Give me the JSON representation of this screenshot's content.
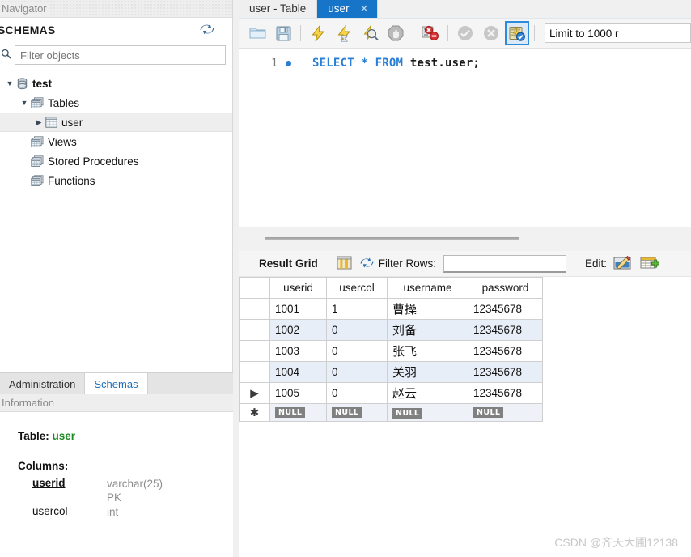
{
  "left_panel": {
    "caption": "Navigator",
    "schemas_title": "SCHEMAS",
    "refresh_icon": "refresh-icon",
    "search_icon": "search-icon",
    "filter_placeholder": "Filter objects",
    "filter_value": "",
    "tree": [
      {
        "label": "test",
        "icon": "database-icon",
        "expander": "▼",
        "depth": 0,
        "bold": true,
        "selected": false
      },
      {
        "label": "Tables",
        "icon": "table-group-icon",
        "expander": "▼",
        "depth": 1,
        "bold": false,
        "selected": false
      },
      {
        "label": "user",
        "icon": "table-icon",
        "expander": "▶",
        "depth": 2,
        "bold": false,
        "selected": true
      },
      {
        "label": "Views",
        "icon": "table-group-icon",
        "expander": "",
        "depth": 1,
        "bold": false,
        "selected": false
      },
      {
        "label": "Stored Procedures",
        "icon": "table-group-icon",
        "expander": "",
        "depth": 1,
        "bold": false,
        "selected": false
      },
      {
        "label": "Functions",
        "icon": "table-group-icon",
        "expander": "",
        "depth": 1,
        "bold": false,
        "selected": false
      }
    ],
    "bottom_tabs": [
      {
        "label": "Administration",
        "active": false
      },
      {
        "label": "Schemas",
        "active": true
      }
    ],
    "information": {
      "caption": "Information",
      "table_label": "Table:",
      "table_name": "user",
      "columns_label": "Columns:",
      "columns": [
        {
          "name": "userid",
          "type": "varchar(25)",
          "extra": "PK",
          "pk": true
        },
        {
          "name": "usercol",
          "type": "int",
          "extra": "",
          "pk": false
        }
      ]
    }
  },
  "editor": {
    "tabs": [
      {
        "label": "user - Table",
        "active": false,
        "closable": false
      },
      {
        "label": "user",
        "active": true,
        "closable": true,
        "close_icon": "close-icon"
      }
    ],
    "toolbar": {
      "buttons": [
        {
          "name": "open-sql-script-icon",
          "title": "Open SQL Script"
        },
        {
          "name": "save-sql-script-icon",
          "title": "Save SQL Script"
        },
        {
          "name": "execute-statement-icon",
          "title": "Execute"
        },
        {
          "name": "execute-current-statement-icon",
          "title": "Execute Current Statement"
        },
        {
          "name": "explain-query-icon",
          "title": "Explain Current Statement"
        },
        {
          "name": "stop-execution-icon",
          "title": "Stop"
        },
        {
          "name": "toggle-stop-on-error-icon",
          "title": "Toggle Stop On Error"
        },
        {
          "name": "commit-icon",
          "title": "Commit"
        },
        {
          "name": "rollback-icon",
          "title": "Rollback"
        },
        {
          "name": "toggle-autocommit-icon",
          "title": "Toggle Autocommit",
          "selected": true
        }
      ],
      "limit_label": "Limit to 1000 r"
    },
    "sql": {
      "line_number": "1",
      "breakpoint_marker": "statement-dot",
      "tokens": [
        {
          "text": "SELECT ",
          "type": "keyword"
        },
        {
          "text": "* ",
          "type": "keyword"
        },
        {
          "text": "FROM ",
          "type": "keyword"
        },
        {
          "text": "test.user;",
          "type": "identifier"
        }
      ]
    }
  },
  "results": {
    "toolbar": {
      "result_grid_label": "Result Grid",
      "grid_view_icon": "grid-view-icon",
      "refresh_icon": "refresh-icon",
      "filter_rows_label": "Filter Rows:",
      "filter_rows_value": "",
      "filter_rows_placeholder": "",
      "edit_label": "Edit:",
      "edit_icon": "edit-row-icon",
      "insert_icon": "insert-row-icon"
    },
    "columns": [
      "userid",
      "usercol",
      "username",
      "password"
    ],
    "rows": [
      {
        "marker": "",
        "userid": "1001",
        "usercol": "1",
        "username": "曹操",
        "password": "12345678"
      },
      {
        "marker": "",
        "userid": "1002",
        "usercol": "0",
        "username": "刘备",
        "password": "12345678"
      },
      {
        "marker": "",
        "userid": "1003",
        "usercol": "0",
        "username": "张飞",
        "password": "12345678"
      },
      {
        "marker": "",
        "userid": "1004",
        "usercol": "0",
        "username": "关羽",
        "password": "12345678"
      },
      {
        "marker": "▶",
        "userid": "1005",
        "usercol": "0",
        "username": "赵云",
        "password": "12345678"
      }
    ],
    "new_row": {
      "marker": "✱",
      "null_label": "NULL"
    }
  },
  "watermark": "CSDN @齐天大圃12138",
  "colors": {
    "active_tab_blue": "#1675c8",
    "sql_keyword_blue": "#2a7fd4",
    "table_name_green": "#1a8a22",
    "alt_row_blue": "#e8eef7",
    "selection_gray": "#eeeeee"
  }
}
